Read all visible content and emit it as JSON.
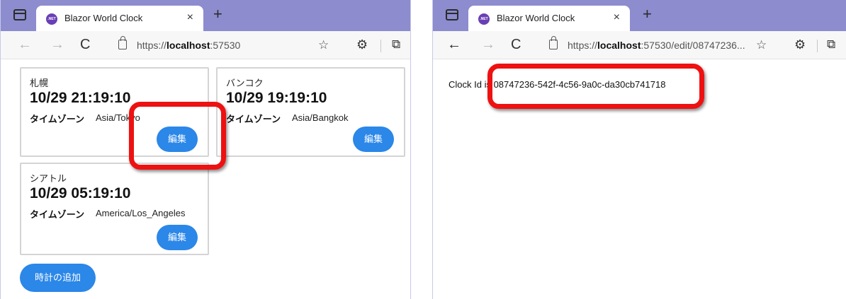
{
  "left_window": {
    "tab_title": "Blazor World Clock",
    "url_prefix": "https://",
    "url_host": "localhost",
    "url_rest": ":57530",
    "clocks": [
      {
        "city": "札幌",
        "time": "10/29 21:19:10",
        "tz_label": "タイムゾーン",
        "tz_value": "Asia/Tokyo",
        "edit_label": "編集"
      },
      {
        "city": "バンコク",
        "time": "10/29 19:19:10",
        "tz_label": "タイムゾーン",
        "tz_value": "Asia/Bangkok",
        "edit_label": "編集"
      },
      {
        "city": "シアトル",
        "time": "10/29 05:19:10",
        "tz_label": "タイムゾーン",
        "tz_value": "America/Los_Angeles",
        "edit_label": "編集"
      }
    ],
    "add_button_label": "時計の追加"
  },
  "right_window": {
    "tab_title": "Blazor World Clock",
    "url_prefix": "https://",
    "url_host": "localhost",
    "url_rest": ":57530/edit/08747236...",
    "clock_id_text": "Clock Id is 08747236-542f-4c56-9a0c-da30cb741718"
  },
  "icons": {
    "tab_close": "×",
    "new_tab": "+",
    "back": "←",
    "forward": "→",
    "reload": "C",
    "favorites": "☆",
    "extensions": "⚙",
    "collections": "⧉",
    "favicon_text": ".NET"
  },
  "colors": {
    "tabbar": "#8c8ccf",
    "button": "#2b87e8",
    "highlight": "#ee1111"
  }
}
